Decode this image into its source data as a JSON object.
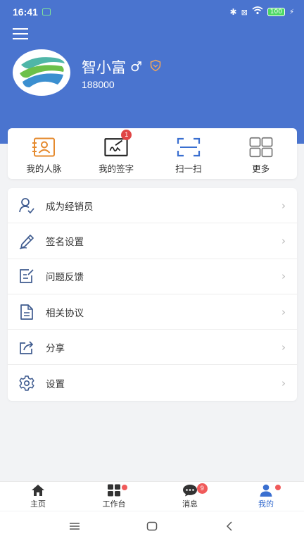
{
  "status": {
    "time": "16:41",
    "battery": "100"
  },
  "profile": {
    "name": "智小富",
    "gender_symbol": "♂",
    "id": "188000"
  },
  "quick_actions": [
    {
      "label": "我的人脉",
      "icon": "contacts-icon"
    },
    {
      "label": "我的签字",
      "icon": "signature-icon",
      "badge": "1"
    },
    {
      "label": "扫一扫",
      "icon": "scan-icon"
    },
    {
      "label": "更多",
      "icon": "more-grid-icon"
    }
  ],
  "menu": [
    {
      "label": "成为经销员",
      "icon": "user-check-icon"
    },
    {
      "label": "签名设置",
      "icon": "pen-icon"
    },
    {
      "label": "问题反馈",
      "icon": "feedback-icon"
    },
    {
      "label": "相关协议",
      "icon": "document-icon"
    },
    {
      "label": "分享",
      "icon": "share-icon"
    },
    {
      "label": "设置",
      "icon": "gear-icon"
    }
  ],
  "tabs": [
    {
      "label": "主页",
      "icon": "home-icon"
    },
    {
      "label": "工作台",
      "icon": "workbench-icon"
    },
    {
      "label": "消息",
      "icon": "message-icon",
      "badge": "9"
    },
    {
      "label": "我的",
      "icon": "profile-icon"
    }
  ],
  "colors": {
    "header": "#4a74cf",
    "accent": "#3a6fd0",
    "badge": "#e04545",
    "contacts": "#e58a2e"
  }
}
